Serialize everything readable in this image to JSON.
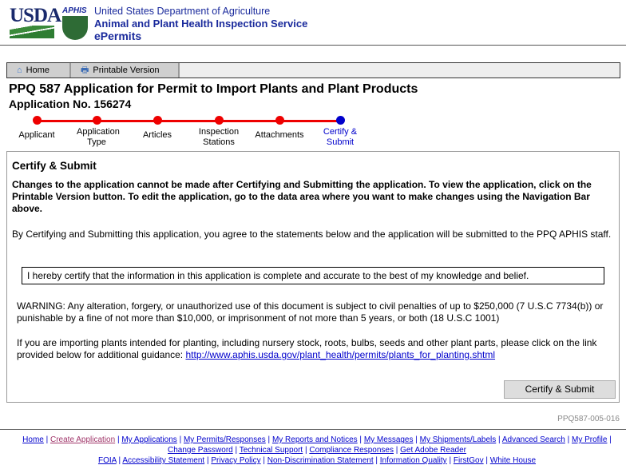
{
  "header": {
    "usda": "USDA",
    "aphis": "APHIS",
    "line1": "United States Department of Agriculture",
    "line2": "Animal and Plant Health Inspection Service",
    "line3": "ePermits"
  },
  "toolbar": {
    "home": "Home",
    "printable": "Printable Version"
  },
  "page": {
    "title": "PPQ 587 Application for Permit to Import Plants and Plant Products",
    "app_no": "Application No. 156274"
  },
  "steps": [
    {
      "label": "Applicant",
      "color": "#e00000"
    },
    {
      "label": "Application Type",
      "color": "#e00000"
    },
    {
      "label": "Articles",
      "color": "#e00000"
    },
    {
      "label": "Inspection Stations",
      "color": "#e00000"
    },
    {
      "label": "Attachments",
      "color": "#e00000"
    },
    {
      "label": "Certify & Submit",
      "color": "#0000cc"
    }
  ],
  "section": {
    "heading": "Certify & Submit",
    "notice": "Changes to the application cannot be made after Certifying and Submitting the application.  To view the application, click on the Printable Version button.  To edit the application, go to the data area where you want to make changes using the Navigation Bar above.",
    "agree": "By Certifying and Submitting this application, you agree to the statements below and the application will be submitted to the PPQ APHIS staff.",
    "certify": "I hereby certify that the information in this application is complete and accurate to the best of my knowledge and belief.",
    "warning": "WARNING: Any alteration, forgery, or unauthorized use of this document is subject to civil penalties of up to $250,000 (7 U.S.C 7734(b)) or punishable by a fine of not more than $10,000, or imprisonment of not more than 5 years, or both (18 U.S.C 1001)",
    "planting": "If you are importing plants intended for planting, including nursery stock, roots, bulbs, seeds and other plant parts, please click on the link provided below for additional guidance: ",
    "link": "http://www.aphis.usda.gov/plant_health/permits/plants_for_planting.shtml",
    "button": "Certify & Submit"
  },
  "ref": "PPQ587-005-016",
  "footer": {
    "row1": [
      "Home",
      "Create Application",
      "My Applications",
      "My Permits/Responses",
      "My Reports and Notices",
      "My Messages",
      "My Shipments/Labels",
      "Advanced Search",
      "My Profile",
      "Change Password",
      "Technical Support",
      "Compliance Responses",
      "Get Adobe Reader"
    ],
    "row2": [
      "FOIA",
      "Accessibility Statement",
      "Privacy Policy",
      "Non-Discrimination Statement",
      "Information Quality",
      "FirstGov",
      "White House"
    ]
  }
}
